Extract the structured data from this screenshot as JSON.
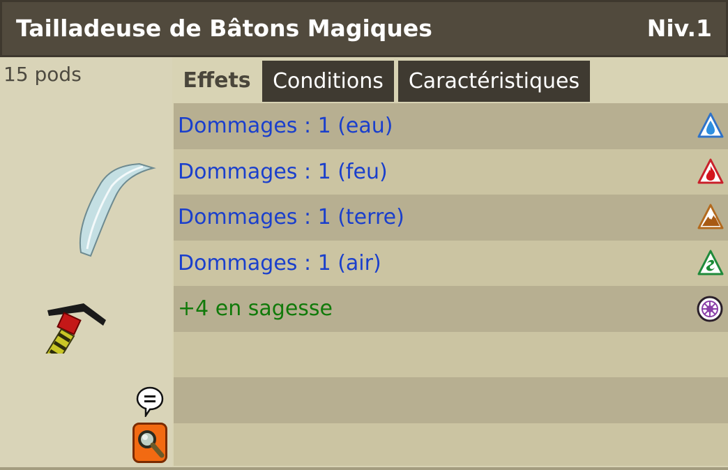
{
  "header": {
    "title": "Tailladeuse de Bâtons Magiques",
    "level": "Niv.1"
  },
  "item": {
    "weight": "15 pods"
  },
  "tabs": [
    {
      "label": "Effets",
      "active": true
    },
    {
      "label": "Conditions",
      "active": false
    },
    {
      "label": "Caractéristiques",
      "active": false
    }
  ],
  "effects": [
    {
      "text": "Dommages : 1 (eau)",
      "icon": "water-element-icon",
      "color": "#1a3fcc"
    },
    {
      "text": "Dommages : 1 (feu)",
      "icon": "fire-element-icon",
      "color": "#1a3fcc"
    },
    {
      "text": "Dommages : 1 (terre)",
      "icon": "earth-element-icon",
      "color": "#1a3fcc"
    },
    {
      "text": "Dommages : 1 (air)",
      "icon": "air-element-icon",
      "color": "#1a3fcc"
    },
    {
      "text": "+4 en sagesse",
      "icon": "wisdom-icon",
      "color": "#117a0a"
    }
  ],
  "colors": {
    "header": "#514a3d",
    "panel": "#d8d3b4",
    "row_dark": "#b7af91",
    "row_light": "#cbc4a2"
  }
}
